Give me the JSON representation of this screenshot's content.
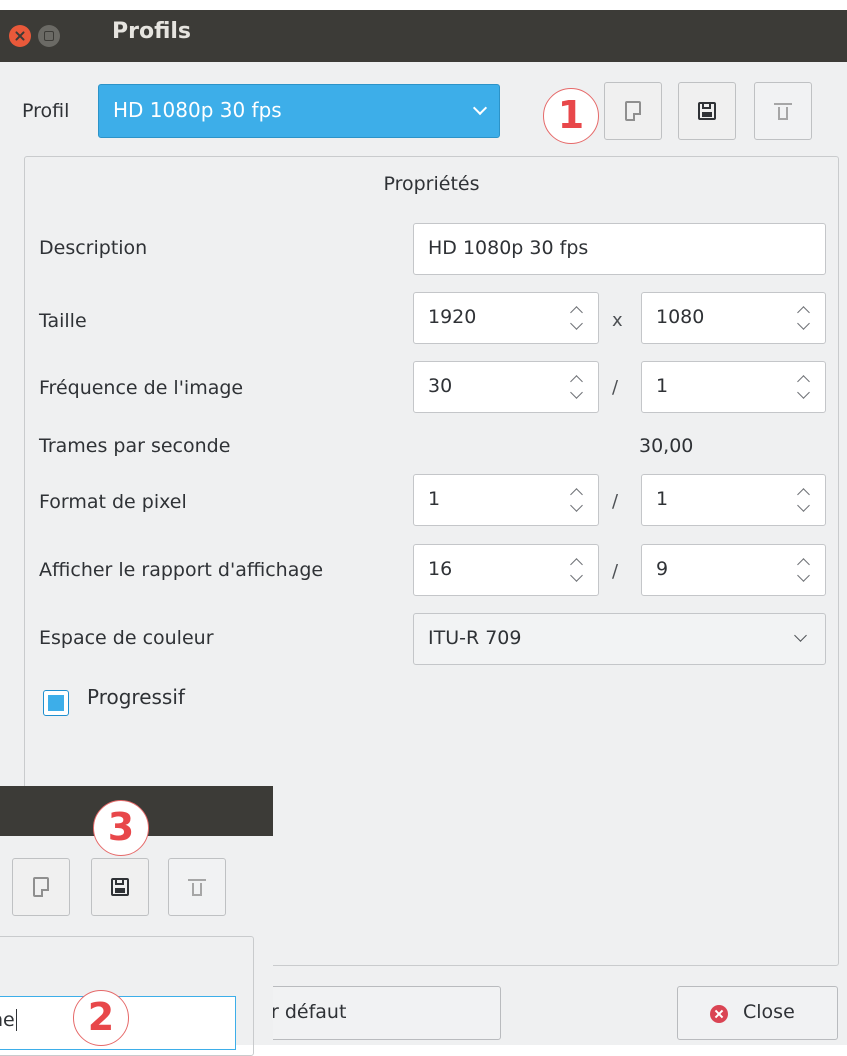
{
  "window": {
    "title": "Profils"
  },
  "profile_row": {
    "label": "Profil",
    "selected_profile": "HD 1080p 30 fps"
  },
  "annotations": {
    "badge_1": "1",
    "badge_2": "2",
    "badge_3": "3",
    "color": "#e8474a"
  },
  "properties": {
    "group_title": "Propriétés",
    "description": {
      "label": "Description",
      "value": "HD 1080p 30 fps"
    },
    "size": {
      "label": "Taille",
      "width": "1920",
      "separator": "x",
      "height": "1080"
    },
    "frame_rate": {
      "label": "Fréquence de l'image",
      "numerator": "30",
      "separator": "/",
      "denominator": "1"
    },
    "fps": {
      "label": "Trames par seconde",
      "value": "30,00"
    },
    "pixel_format": {
      "label": "Format de pixel",
      "numerator": "1",
      "separator": "/",
      "denominator": "1"
    },
    "display_ratio": {
      "label": "Afficher le rapport d'affichage",
      "numerator": "16",
      "separator": "/",
      "denominator": "9"
    },
    "color_space": {
      "label": "Espace de couleur",
      "value": "ITU-R 709"
    },
    "progressive": {
      "label": "Progressif",
      "checked": true
    }
  },
  "buttons": {
    "default_partial": "r défaut",
    "close": "Close"
  },
  "overlay": {
    "input_partial_text": "ne"
  },
  "colors": {
    "accent": "#3daee9",
    "titlebar": "#3c3b37",
    "window_bg": "#eff0f1",
    "close_dot": "#e9593a"
  }
}
